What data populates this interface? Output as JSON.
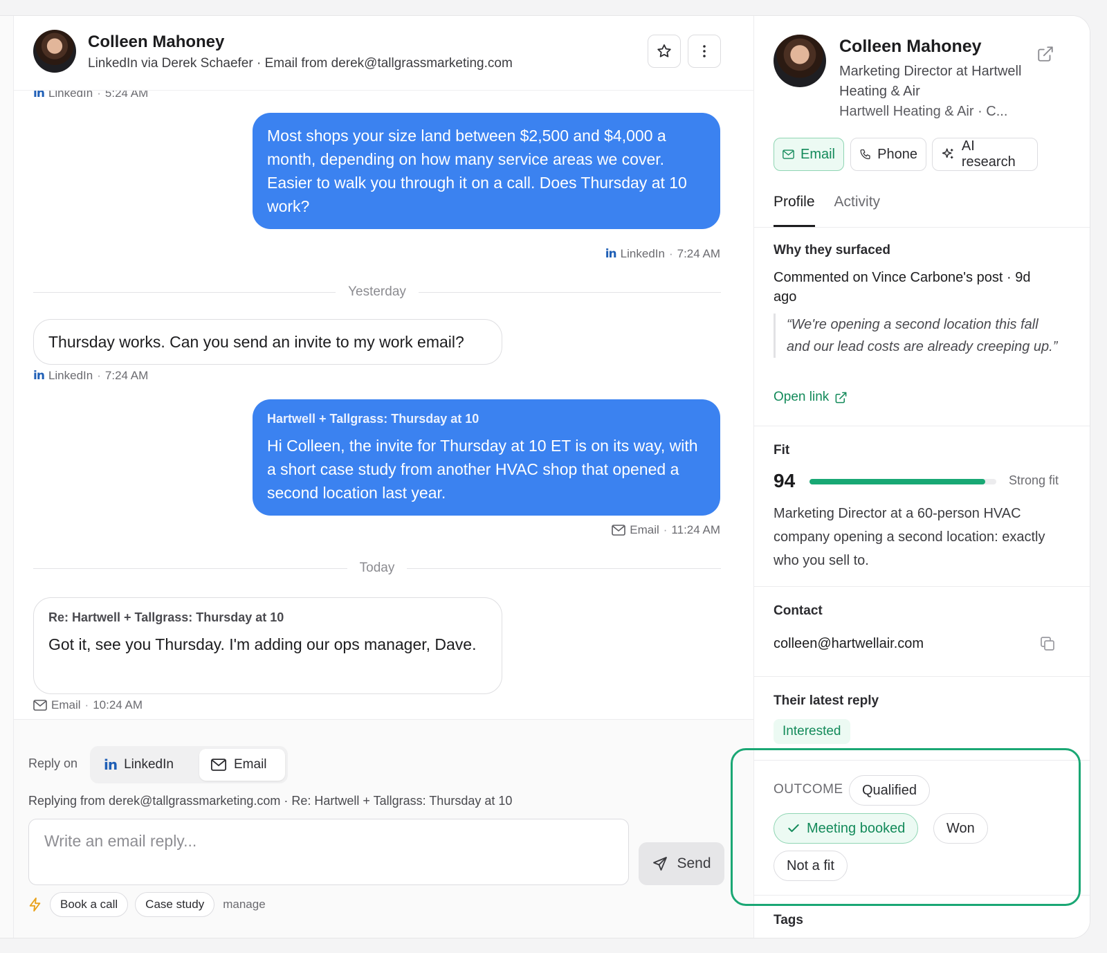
{
  "header": {
    "name": "Colleen Mahoney",
    "subtitle": "LinkedIn via Derek Schaefer · Email from derek@tallgrassmarketing.com"
  },
  "messages": {
    "clipped_meta": {
      "channel": "LinkedIn",
      "time": "5:24 AM"
    },
    "m1": {
      "text": "Most shops your size land between $2,500 and $4,000 a month, depending on how many service areas we cover. Easier to walk you through it on a call. Does Thursday at 10 work?",
      "channel": "LinkedIn",
      "time": "7:24 AM"
    },
    "divider_yesterday": "Yesterday",
    "m2": {
      "text": "Thursday works. Can you send an invite to my work email?",
      "channel": "LinkedIn",
      "time": "7:24 AM"
    },
    "m3": {
      "subject": "Hartwell + Tallgrass: Thursday at 10",
      "text": "Hi Colleen, the invite for Thursday at 10 ET is on its way, with a short case study from another HVAC shop that opened a second location last year.",
      "channel": "Email",
      "time": "11:24 AM"
    },
    "divider_today": "Today",
    "m4": {
      "subject": "Re: Hartwell + Tallgrass: Thursday at 10",
      "text": "Got it, see you Thursday. I'm adding our ops manager, Dave.",
      "channel": "Email",
      "time": "10:24 AM"
    }
  },
  "composer": {
    "reply_on": "Reply on",
    "channel_linkedin": "LinkedIn",
    "channel_email": "Email",
    "replying_from": "Replying from derek@tallgrassmarketing.com · Re: Hartwell + Tallgrass: Thursday at 10",
    "placeholder": "Write an email reply...",
    "send": "Send",
    "quick_replies": [
      "Book a call",
      "Case study"
    ],
    "manage": "manage"
  },
  "profile": {
    "name": "Colleen Mahoney",
    "title": "Marketing Director at Hartwell Heating & Air",
    "company_line": "Hartwell Heating & Air · C...",
    "actions": {
      "email": "Email",
      "phone": "Phone",
      "ai": "AI research"
    },
    "tabs": [
      "Profile",
      "Activity"
    ],
    "why": {
      "heading": "Why they surfaced",
      "text": "Commented on Vince Carbone's post · 9d ago",
      "quote": "“We're opening a second location this fall and our lead costs are already creeping up.”",
      "link": "Open link"
    },
    "fit": {
      "heading": "Fit",
      "score": "94",
      "fraction": 0.94,
      "label": "Strong fit",
      "desc": "Marketing Director at a 60-person HVAC company opening a second location: exactly who you sell to."
    },
    "contact": {
      "heading": "Contact",
      "email": "colleen@hartwellair.com"
    },
    "latest": {
      "heading": "Their latest reply",
      "badge": "Interested"
    },
    "outcome": {
      "label": "OUTCOME",
      "options": [
        "Qualified",
        "Meeting booked",
        "Won",
        "Not a fit"
      ],
      "selected": "Meeting booked"
    },
    "next_heading": "Tags"
  },
  "colors": {
    "accent_blue": "#3b82f0",
    "accent_green": "#1aa774"
  }
}
